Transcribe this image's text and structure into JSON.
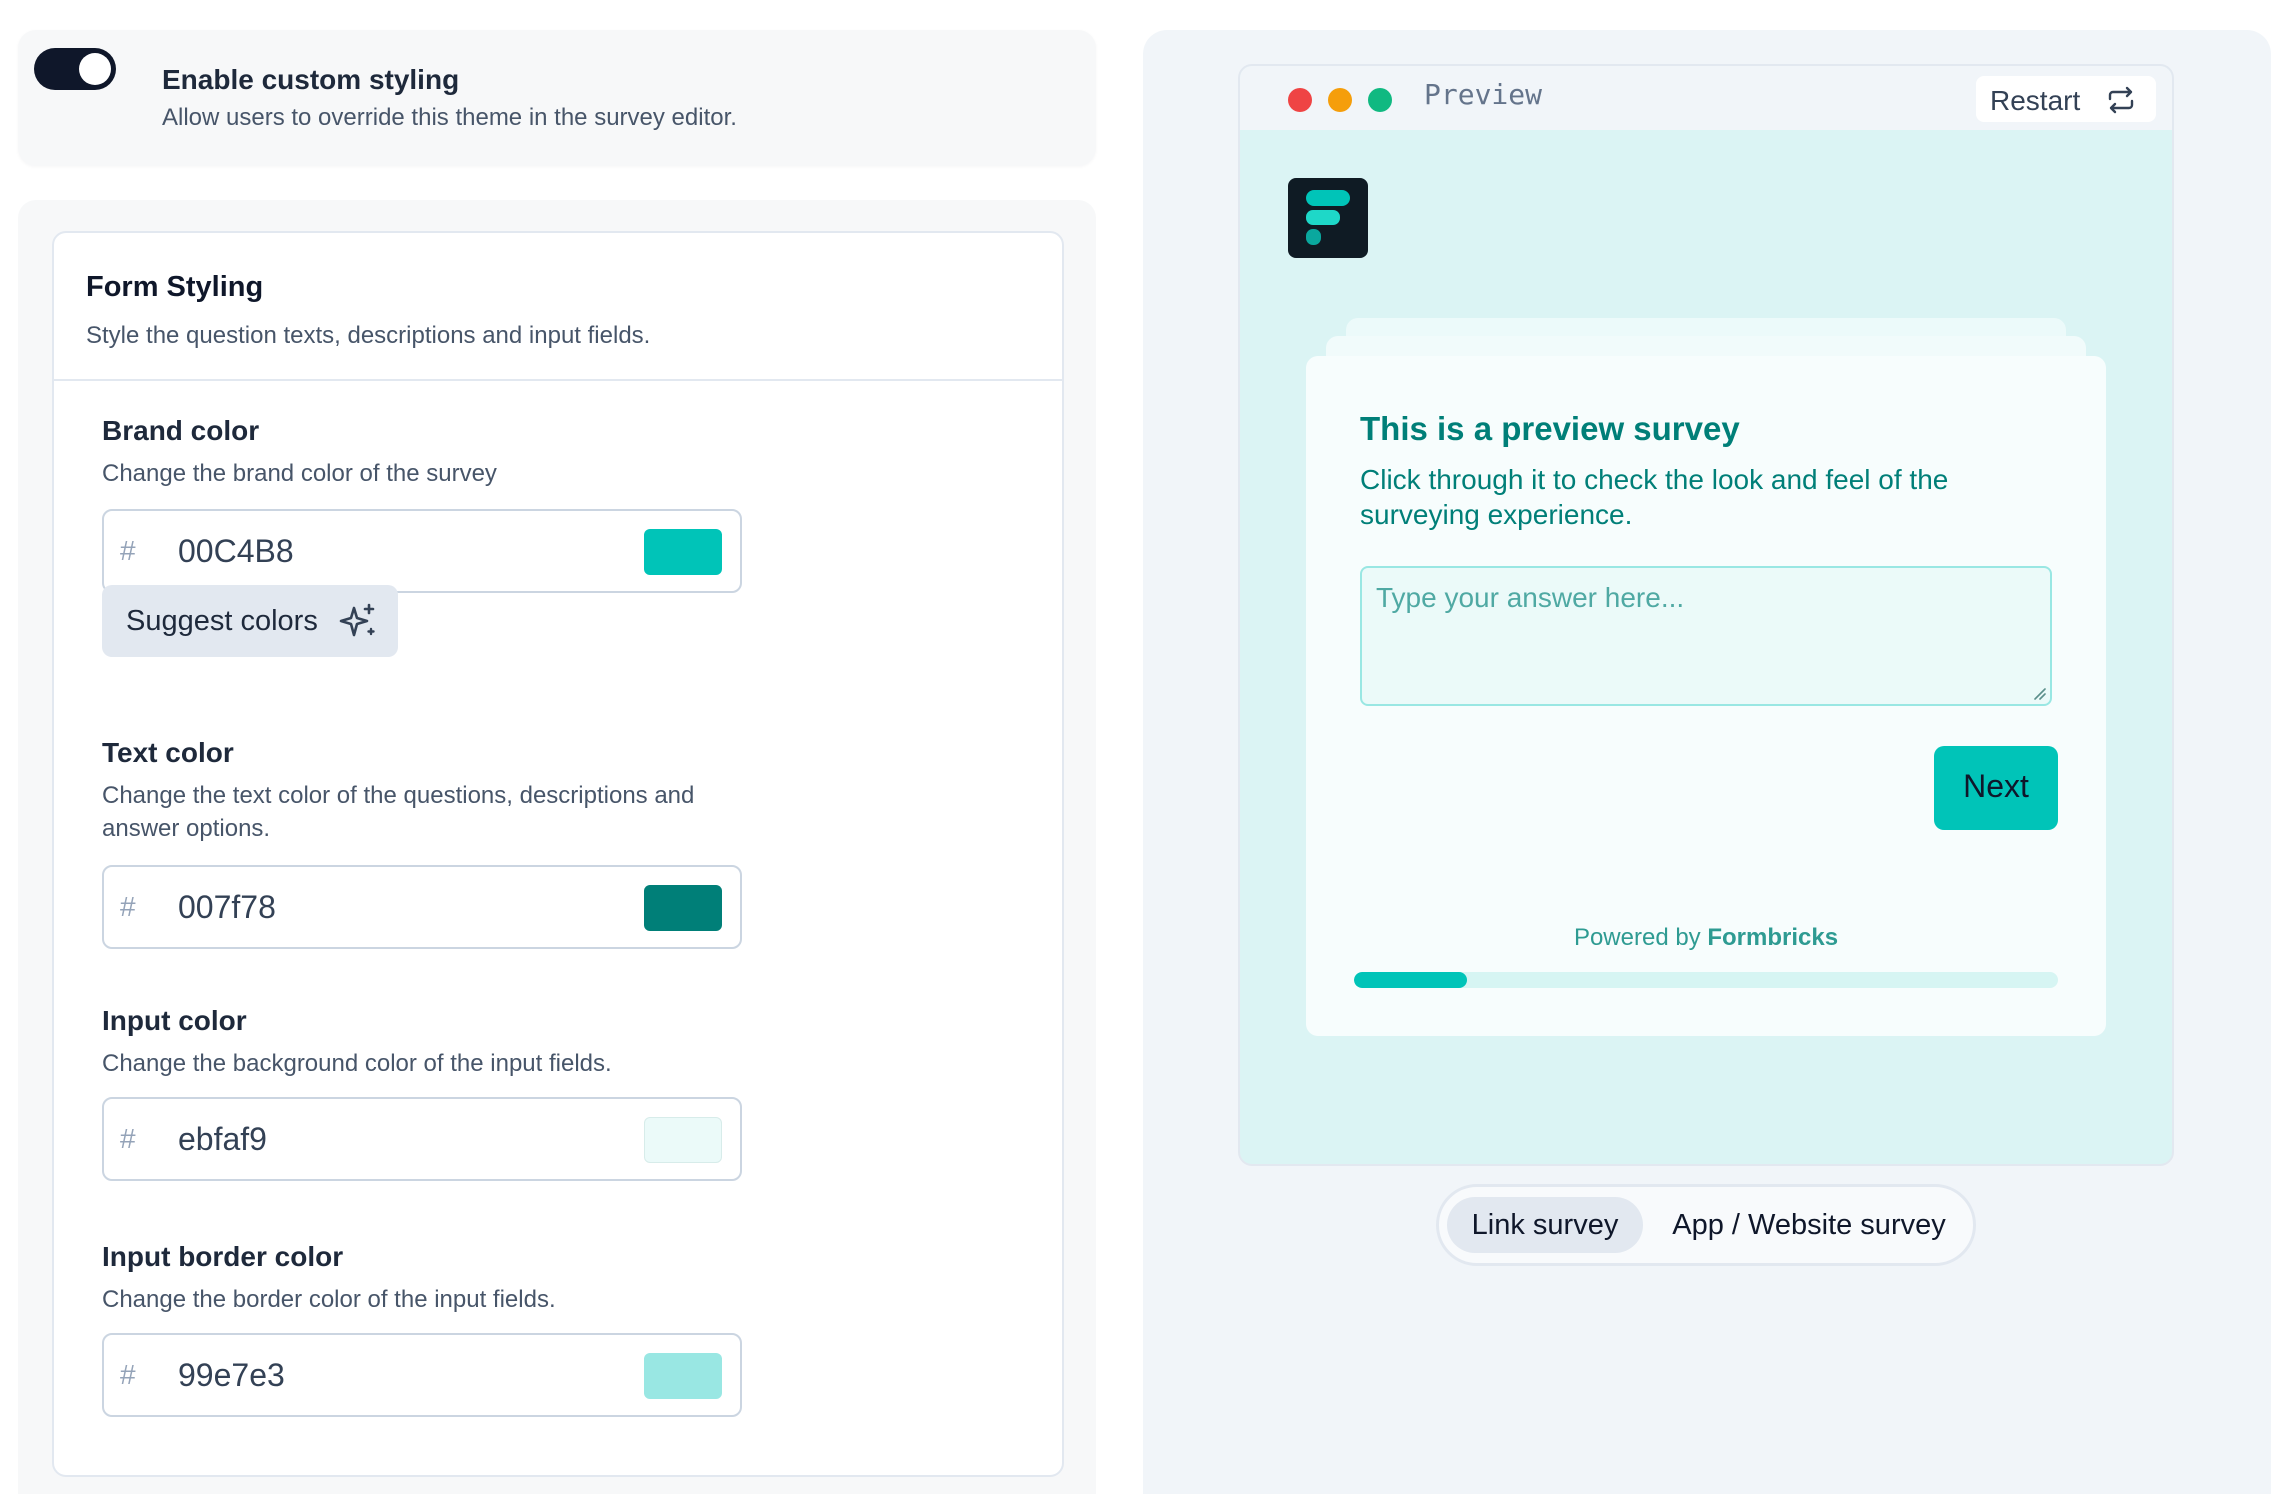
{
  "custom_styling": {
    "enabled": true,
    "title": "Enable custom styling",
    "description": "Allow users to override this theme in the survey editor."
  },
  "form_styling": {
    "title": "Form Styling",
    "subtitle": "Style the question texts, descriptions and input fields.",
    "hash_symbol": "#",
    "fields": [
      {
        "label": "Brand color",
        "description": "Change the brand color of the survey",
        "value": "00C4B8",
        "swatch": "#00C4B8"
      },
      {
        "label": "Text color",
        "description": "Change the text color of the questions, descriptions and answer options.",
        "value": "007f78",
        "swatch": "#007f78"
      },
      {
        "label": "Input color",
        "description": "Change the background color of the input fields.",
        "value": "ebfaf9",
        "swatch": "#ebfaf9"
      },
      {
        "label": "Input border color",
        "description": "Change the border color of the input fields.",
        "value": "99e7e3",
        "swatch": "#99e7e3"
      }
    ],
    "suggest_button": "Suggest colors",
    "suggest_icon": "sparkles-icon"
  },
  "preview": {
    "window_label": "Preview",
    "restart_label": "Restart",
    "restart_icon": "repeat-icon",
    "window_dots": [
      "#ef4444",
      "#f59e0b",
      "#10b981"
    ],
    "logo_icon": "formbricks-logo",
    "survey": {
      "headline": "This is a preview survey",
      "subheader": "Click through it to check the look and feel of the surveying experience.",
      "answer_placeholder": "Type your answer here...",
      "next_label": "Next",
      "powered_prefix": "Powered by ",
      "powered_brand": "Formbricks",
      "progress": 0.16
    },
    "survey_types": [
      {
        "label": "Link survey",
        "active": true
      },
      {
        "label": "App / Website survey",
        "active": false
      }
    ]
  },
  "colors": {
    "brand": "#00C4B8",
    "text": "#007f78",
    "input_bg": "#ebfaf9",
    "input_border": "#99e7e3",
    "toggle_on": "#0f172a"
  }
}
